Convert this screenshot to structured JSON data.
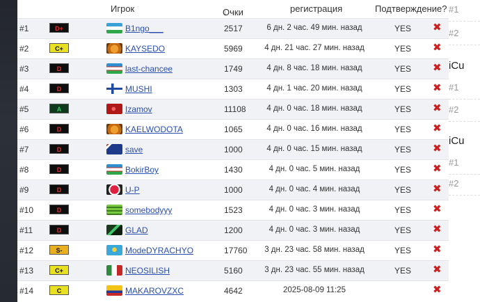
{
  "table": {
    "headers": {
      "player": "Игрок",
      "points_arrow": "↓",
      "points": "Очки",
      "registration": "регистрация",
      "confirmation": "Подтверждение?"
    },
    "rows": [
      {
        "rank": "#1",
        "badge": "D+",
        "badge_color": "#e03030",
        "flag": "uz",
        "player": "B1ngo___",
        "points": "2517",
        "registered": "6 дн. 2 час. 49 мин. назад",
        "confirmed": "YES",
        "remove": "✖"
      },
      {
        "rank": "#2",
        "badge": "C+",
        "badge_color": "#e8e020",
        "flag": "tiger",
        "player": "KAYSEDO",
        "points": "5969",
        "registered": "4 дн. 21 час. 27 мин. назад",
        "confirmed": "YES",
        "remove": "✖"
      },
      {
        "rank": "#3",
        "badge": "D",
        "badge_color": "#e03030",
        "flag": "uz2",
        "player": "last-chancee",
        "points": "1749",
        "registered": "4 дн. 8 час. 18 мин. назад",
        "confirmed": "YES",
        "remove": "✖"
      },
      {
        "rank": "#4",
        "badge": "D",
        "badge_color": "#e03030",
        "flag": "fi",
        "player": "MUSHI",
        "points": "1303",
        "registered": "4 дн. 1 час. 20 мин. назад",
        "confirmed": "YES",
        "remove": "✖"
      },
      {
        "rank": "#5",
        "badge": "A",
        "badge_color": "#3ec46a",
        "flag": "red-star",
        "player": "Izamov",
        "points": "11108",
        "registered": "4 дн. 0 час. 18 мин. назад",
        "confirmed": "YES",
        "remove": "✖"
      },
      {
        "rank": "#6",
        "badge": "D",
        "badge_color": "#e03030",
        "flag": "tiger",
        "player": "KAELWODOTA",
        "points": "1065",
        "registered": "4 дн. 0 час. 16 мин. назад",
        "confirmed": "YES",
        "remove": "✖"
      },
      {
        "rank": "#7",
        "badge": "D",
        "badge_color": "#e03030",
        "flag": "au",
        "player": "save",
        "points": "1000",
        "registered": "4 дн. 0 час. 15 мин. назад",
        "confirmed": "YES",
        "remove": "✖"
      },
      {
        "rank": "#8",
        "badge": "D",
        "badge_color": "#e03030",
        "flag": "uz2",
        "player": "BokirBoy",
        "points": "1430",
        "registered": "4 дн. 0 час. 5 мин. назад",
        "confirmed": "YES",
        "remove": "✖"
      },
      {
        "rank": "#9",
        "badge": "D",
        "badge_color": "#e03030",
        "flag": "heart",
        "player": "U-P",
        "points": "1000",
        "registered": "4 дн. 0 час. 4 мин. назад",
        "confirmed": "YES",
        "remove": "✖"
      },
      {
        "rank": "#10",
        "badge": "D",
        "badge_color": "#e03030",
        "flag": "green-stripes",
        "player": "somebodyyy",
        "points": "1523",
        "registered": "4 дн. 0 час. 3 мин. назад",
        "confirmed": "YES",
        "remove": "✖"
      },
      {
        "rank": "#11",
        "badge": "D",
        "badge_color": "#e03030",
        "flag": "green-dark",
        "player": "GLAD",
        "points": "1200",
        "registered": "4 дн. 0 час. 3 мин. назад",
        "confirmed": "YES",
        "remove": "✖"
      },
      {
        "rank": "#12",
        "badge": "S-",
        "badge_color": "#e8b020",
        "flag": "kz",
        "player": "ModeDYRACHYO",
        "points": "17760",
        "registered": "3 дн. 23 час. 58 мин. назад",
        "confirmed": "YES",
        "remove": "✖"
      },
      {
        "rank": "#13",
        "badge": "C+",
        "badge_color": "#e8e020",
        "flag": "mx",
        "player": "NEOSILISH",
        "points": "5160",
        "registered": "3 дн. 23 час. 55 мин. назад",
        "confirmed": "YES",
        "remove": "✖"
      },
      {
        "rank": "#14",
        "badge": "C",
        "badge_color": "#e8e020",
        "flag": "co",
        "player": "MAKAROVZXC",
        "points": "4642",
        "registered": "2025-08-09 11:25",
        "confirmed": "",
        "remove": "✖"
      }
    ]
  },
  "side_panel": {
    "items": [
      {
        "label": "#1"
      },
      {
        "label": "#2"
      },
      {
        "label": "iCu"
      },
      {
        "label": "#1"
      },
      {
        "label": "#2"
      },
      {
        "label": "iCu"
      },
      {
        "label": "#1"
      },
      {
        "label": "#2"
      }
    ]
  }
}
